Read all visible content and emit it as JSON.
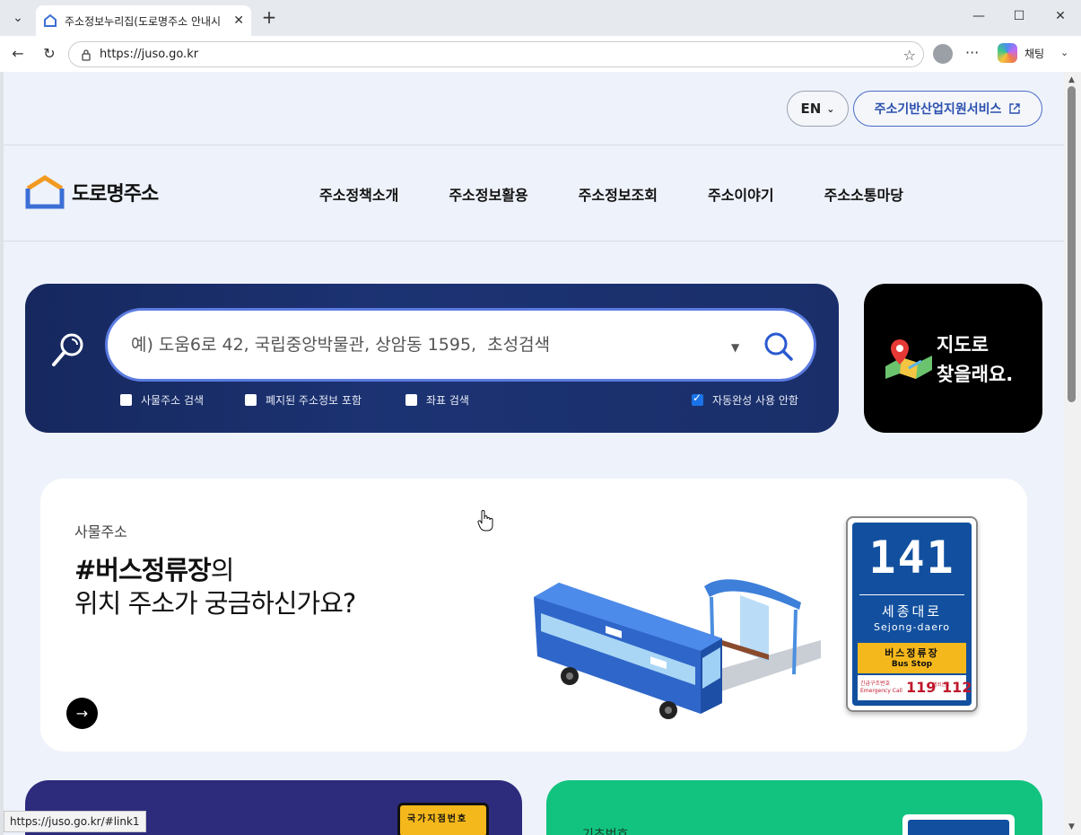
{
  "browser": {
    "tab_title": "주소정보누리집(도로명주소 안내시",
    "url": "https://juso.go.kr",
    "copilot_label": "채팅",
    "status_url": "https://juso.go.kr/#link1"
  },
  "util": {
    "lang": "EN",
    "support_label": "주소기반산업지원서비스"
  },
  "header": {
    "logo_text": "도로명주소",
    "nav": [
      "주소정책소개",
      "주소정보활용",
      "주소정보조회",
      "주소이야기",
      "주소소통마당"
    ]
  },
  "search": {
    "placeholder": "예) 도움6로 42, 국립중앙박물관, 상암동 1595,  초성검색",
    "options": [
      {
        "label": "사물주소 검색",
        "checked": false
      },
      {
        "label": "폐지된 주소정보 포함",
        "checked": false
      },
      {
        "label": "좌표 검색",
        "checked": false
      },
      {
        "label": "자동완성 사용 안함",
        "checked": true
      }
    ]
  },
  "map_card": {
    "line1": "지도로",
    "line2": "찾을래요."
  },
  "banner": {
    "tag": "사물주소",
    "title_highlight": "#버스정류장",
    "title_rest": "의",
    "title_line2": "위치 주소가 궁금하신가요?",
    "sign": {
      "number": "141",
      "name_kr": "세종대로",
      "name_en": "Sejong-daero",
      "stop_kr": "버스정류장",
      "stop_en": "Bus Stop",
      "emergency_label_kr": "긴급구조번호",
      "emergency_label_en": "Emergency Call",
      "num_119": "119",
      "mid_label": "범죄신고",
      "num_112": "112"
    }
  },
  "cards": {
    "purple_sign": "국가지점번호",
    "green_tag": "기초번호"
  },
  "colors": {
    "search_panel": "#1a2f6a",
    "search_border": "#5b7be0",
    "support_text": "#2a4fae",
    "card_purple": "#2d2b7c",
    "card_green": "#11c37e",
    "sign_blue": "#12509f",
    "sign_yellow": "#f5b81c"
  }
}
